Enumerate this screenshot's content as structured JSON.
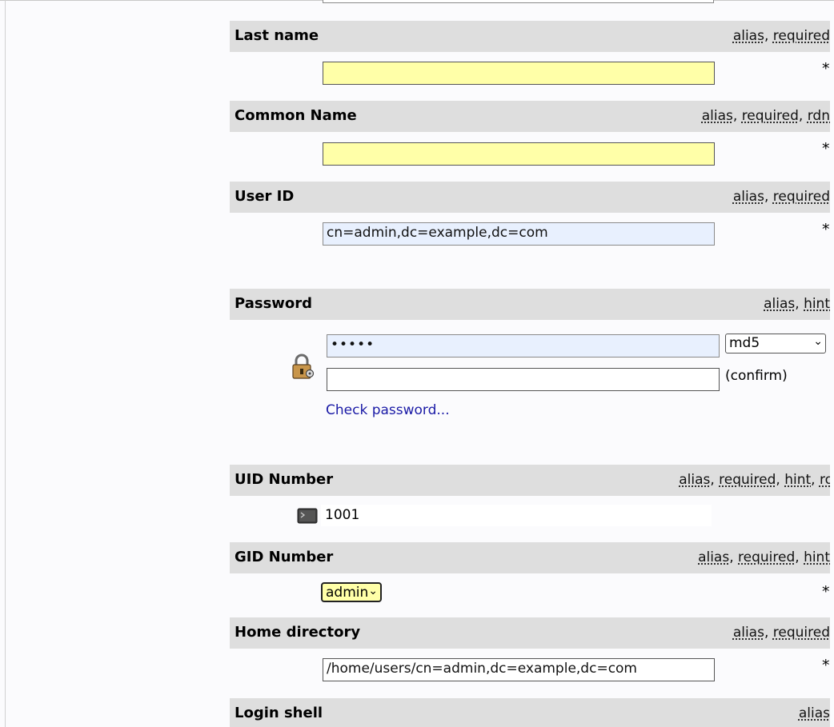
{
  "fields": [
    {
      "label": "Last name",
      "tags": [
        "alias",
        "required"
      ],
      "value": "",
      "required_mark": "*"
    },
    {
      "label": "Common Name",
      "tags": [
        "alias",
        "required",
        "rdn"
      ],
      "value": "",
      "required_mark": "*"
    },
    {
      "label": "User ID",
      "tags": [
        "alias",
        "required"
      ],
      "value": "cn=admin,dc=example,dc=com",
      "required_mark": "*"
    },
    {
      "label": "Password",
      "tags": [
        "alias",
        "hint"
      ],
      "value": "•••••",
      "hash_option": "md5",
      "confirm_label": "(confirm)",
      "check_link": "Check password..."
    },
    {
      "label": "UID Number",
      "tags": [
        "alias",
        "required",
        "hint",
        "ro"
      ],
      "value": "1001"
    },
    {
      "label": "GID Number",
      "tags": [
        "alias",
        "required",
        "hint"
      ],
      "value": "admin",
      "required_mark": "*"
    },
    {
      "label": "Home directory",
      "tags": [
        "alias",
        "required"
      ],
      "value": "/home/users/cn=admin,dc=example,dc=com",
      "required_mark": "*"
    },
    {
      "label": "Login shell",
      "tags": [
        "alias"
      ]
    }
  ],
  "tag_sep": ", ",
  "colors": {
    "header_bg": "#dedede",
    "required_field": "#ffffa8",
    "autofill_field": "#e8f0fe",
    "link": "#1a1aa6"
  }
}
